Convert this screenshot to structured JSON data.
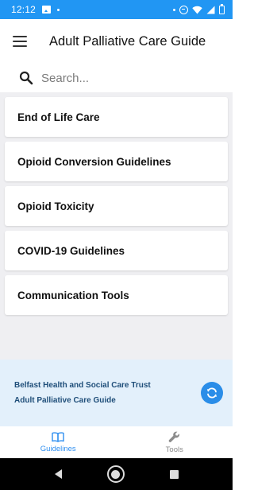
{
  "status_bar": {
    "time": "12:12",
    "left_icons": [
      "image-icon",
      "dot-icon"
    ],
    "right_icons": [
      "dot-icon",
      "do-not-disturb-icon",
      "wifi-icon",
      "signal-icon",
      "battery-icon"
    ],
    "background_color": "#2196f3"
  },
  "app_bar": {
    "title": "Adult Palliative Care Guide",
    "menu_icon": "hamburger-menu-icon"
  },
  "search": {
    "placeholder": "Search...",
    "value": "",
    "icon": "search-icon"
  },
  "guidelines": {
    "items": [
      {
        "label": "End of Life Care"
      },
      {
        "label": "Opioid Conversion Guidelines"
      },
      {
        "label": "Opioid Toxicity"
      },
      {
        "label": "COVID-19 Guidelines"
      },
      {
        "label": "Communication Tools"
      }
    ]
  },
  "footer": {
    "line1": "Belfast Health and Social Care Trust",
    "line2": "Adult Palliative Care Guide",
    "refresh_icon": "refresh-icon",
    "accent_color": "#2a8de8"
  },
  "bottom_nav": {
    "items": [
      {
        "label": "Guidelines",
        "icon": "book-icon",
        "active": true
      },
      {
        "label": "Tools",
        "icon": "wrench-icon",
        "active": false
      }
    ],
    "active_color": "#2f8ff0"
  },
  "system_nav": {
    "buttons": [
      "back-icon",
      "home-icon",
      "recents-icon"
    ]
  }
}
